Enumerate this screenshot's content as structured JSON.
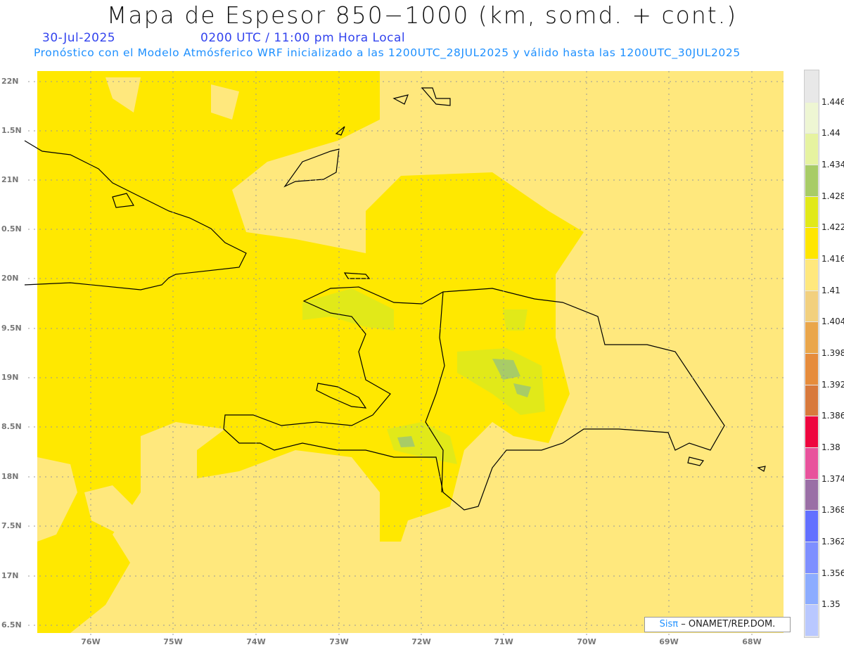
{
  "header": {
    "title": "Mapa de Espesor 850−1000 (km, somd. + cont.)",
    "date": "30-Jul-2025",
    "time": "0200 UTC / 11:00 pm Hora Local",
    "subtitle": "Pronóstico con el Modelo Atmósferico WRF inicializado a las 1200UTC_28JUL2025 y válido hasta las  1200UTC_30JUL2025"
  },
  "map": {
    "lat_labels": [
      "22N",
      "1.5N",
      "21N",
      "0.5N",
      "20N",
      "9.5N",
      "19N",
      "8.5N",
      "18N",
      "7.5N",
      "17N",
      "6.5N"
    ],
    "lon_labels": [
      "76W",
      "75W",
      "74W",
      "73W",
      "72W",
      "71W",
      "70W",
      "69W",
      "68W"
    ]
  },
  "colorbar": {
    "colors": [
      "#b9c8ff",
      "#8cacff",
      "#7e8fff",
      "#6270ff",
      "#9a6fa6",
      "#e8529c",
      "#ee053f",
      "#d8793c",
      "#e68c3c",
      "#ea a64a",
      "#f2d07e",
      "#ffe87d",
      "#ffe600",
      "#e1e919",
      "#a8cc66",
      "#e6f3a0",
      "#eef6d3",
      "#e8e8e8"
    ],
    "labels": [
      "1.446",
      "1.44",
      "1.434",
      "1.428",
      "1.422",
      "1.416",
      "1.41",
      "1.404",
      "1.398",
      "1.392",
      "1.386",
      "1.38",
      "1.374",
      "1.368",
      "1.362",
      "1.356",
      "1.35"
    ]
  },
  "credit": {
    "brand": "Sisπ",
    "text": "– ONAMET/REP.DOM."
  }
}
